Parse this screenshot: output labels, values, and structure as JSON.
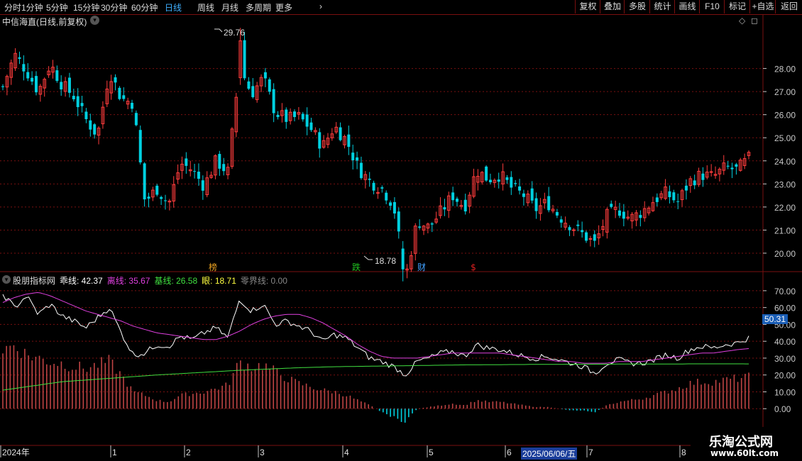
{
  "toolbar": {
    "periods": [
      "分时",
      "1分钟",
      "5分钟",
      "15分钟",
      "30分钟",
      "60分钟",
      "日线",
      "周线",
      "月线",
      "多周期",
      "更多"
    ],
    "more_arrow": "›",
    "active_period": "日线",
    "actions": [
      "复权",
      "叠加",
      "多股",
      "统计",
      "画线",
      "F10",
      "标记",
      "+自选",
      "返回"
    ]
  },
  "main_chart": {
    "title": "中信海直(日线,前复权)",
    "high_label": "29.76",
    "low_label": "18.78",
    "event_markers": [
      {
        "text": "榜",
        "color": "#e8a020"
      },
      {
        "text": "跌",
        "color": "#20c020"
      },
      {
        "text": "财",
        "color": "#40a0ff"
      },
      {
        "text": "$",
        "color": "#e02020"
      }
    ]
  },
  "indicator": {
    "name": "股朋指标网",
    "lines": [
      {
        "label": "乖线:",
        "value": "42.37",
        "color": "#ffffff"
      },
      {
        "label": "离线:",
        "value": "35.67",
        "color": "#e040e0"
      },
      {
        "label": "基线:",
        "value": "26.58",
        "color": "#40e040"
      },
      {
        "label": "眼:",
        "value": "18.71",
        "color": "#ffff40"
      },
      {
        "label": "零界线:",
        "value": "0.00",
        "color": "#888888"
      }
    ],
    "current_value_badge": "50.31"
  },
  "price_axis": [
    "28.00",
    "27.00",
    "26.00",
    "25.00",
    "24.00",
    "23.00",
    "22.00",
    "21.00",
    "20.00"
  ],
  "indicator_axis": [
    "70.00",
    "60.00",
    "50.00",
    "40.00",
    "30.00",
    "20.00",
    "10.00",
    "0.00"
  ],
  "date_axis": {
    "labels": [
      "2024年",
      "1",
      "2",
      "3",
      "4",
      "5",
      "6",
      "7",
      "8"
    ],
    "cursor_date": "2025/06/06/五"
  },
  "watermark": {
    "line1": "乐淘公式网",
    "line2": "www.60lt.com"
  },
  "colors": {
    "up": "#ff3c3c",
    "down": "#00d0e0",
    "grid": "#7a1010",
    "accent": "#3fb0ff"
  },
  "chart_data": {
    "type": "line",
    "price_ylim": [
      19.2,
      29.8
    ],
    "indicator_ylim": [
      -10,
      75
    ],
    "price_high": 29.76,
    "price_low": 18.78,
    "close_path": [
      27.2,
      28.6,
      27.9,
      27.0,
      28.2,
      27.3,
      26.8,
      25.8,
      25.1,
      27.9,
      26.7,
      26.5,
      22.2,
      22.8,
      22.1,
      23.9,
      23.6,
      22.9,
      24.0,
      23.5,
      28.1,
      26.9,
      27.6,
      26.1,
      25.8,
      25.9,
      25.4,
      24.6,
      25.5,
      24.9,
      23.7,
      23.1,
      22.8,
      22.1,
      18.9,
      21.4,
      21.1,
      21.8,
      22.5,
      22.0,
      23.6,
      23.2,
      23.4,
      22.8,
      22.5,
      21.9,
      22.2,
      21.6,
      21.2,
      20.8,
      20.4,
      21.6,
      21.9,
      21.5,
      21.8,
      22.3,
      22.6,
      22.2,
      23.1,
      23.4,
      23.3,
      23.7,
      23.6,
      24.1
    ],
    "series": [
      {
        "name": "乖线",
        "values": [
          68,
          60,
          67,
          56,
          62,
          55,
          52,
          48,
          54,
          60,
          45,
          32,
          33,
          38,
          37,
          43,
          41,
          45,
          48,
          42,
          65,
          58,
          62,
          50,
          52,
          49,
          46,
          40,
          44,
          42,
          36,
          30,
          28,
          25,
          20,
          28,
          30,
          33,
          34,
          31,
          38,
          36,
          35,
          33,
          31,
          30,
          31,
          29,
          27,
          25,
          21,
          27,
          29,
          27,
          27,
          29,
          32,
          30,
          35,
          37,
          36,
          38,
          39,
          42
        ]
      },
      {
        "name": "离线",
        "values": [
          63,
          66,
          68,
          69,
          67,
          64,
          61,
          58,
          56,
          54,
          52,
          49,
          47,
          45,
          44,
          43,
          42,
          41,
          41,
          43,
          46,
          50,
          53,
          55,
          56,
          56,
          54,
          51,
          47,
          43,
          38,
          34,
          31,
          30,
          30,
          30,
          31,
          32,
          33,
          33,
          33,
          33,
          33,
          32,
          31,
          30,
          29,
          28,
          28,
          27,
          27,
          27,
          28,
          28,
          28,
          29,
          30,
          31,
          32,
          33,
          33,
          34,
          35,
          35.67
        ]
      },
      {
        "name": "基线",
        "values": [
          11,
          12,
          13,
          14,
          15,
          16,
          16.5,
          17,
          17.5,
          18,
          18.5,
          19,
          19.5,
          20,
          20.4,
          20.8,
          21.2,
          21.6,
          22,
          22.4,
          22.8,
          23.1,
          23.4,
          23.7,
          24,
          24.3,
          24.5,
          24.7,
          24.9,
          25,
          25.1,
          25.2,
          25.3,
          25.4,
          25.5,
          25.6,
          25.7,
          25.8,
          25.9,
          26,
          26,
          26.1,
          26.1,
          26.2,
          26.2,
          26.3,
          26.3,
          26.3,
          26.4,
          26.4,
          26.4,
          26.4,
          26.5,
          26.5,
          26.5,
          26.5,
          26.5,
          26.5,
          26.6,
          26.6,
          26.6,
          26.6,
          26.6,
          26.58
        ]
      },
      {
        "name": "眼",
        "values": [
          35,
          38,
          32,
          30,
          28,
          27,
          25,
          24,
          26,
          28,
          20,
          10,
          8,
          5,
          4,
          8,
          9,
          10,
          12,
          14,
          28,
          25,
          26,
          22,
          18,
          15,
          13,
          11,
          10,
          8,
          5,
          2,
          -2,
          -5,
          -8,
          0,
          1,
          2,
          3,
          2,
          5,
          4,
          4,
          3,
          2,
          1,
          1,
          0,
          -1,
          -1,
          -2,
          2,
          4,
          5,
          6,
          8,
          10,
          12,
          15,
          16,
          16,
          17,
          18,
          18.71
        ]
      }
    ]
  }
}
